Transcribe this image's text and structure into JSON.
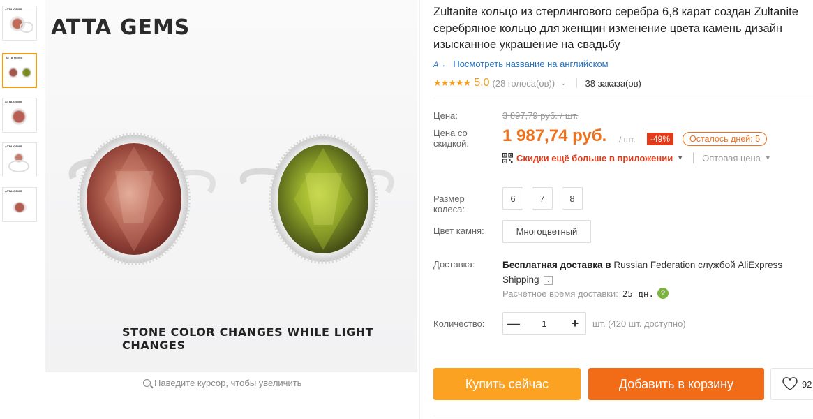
{
  "gallery": {
    "brand_logo": "ATTA GEMS",
    "caption": "STONE COLOR CHANGES WHILE LIGHT CHANGES",
    "zoom_hint": "Наведите курсор, чтобы увеличить",
    "thumbnails": [
      {
        "label": "ATTA GEMS",
        "active": false
      },
      {
        "label": "ATTA GEMS",
        "active": true
      },
      {
        "label": "ATTA GEMS",
        "active": false
      },
      {
        "label": "ATTA GEMS",
        "active": false
      },
      {
        "label": "ATTA GEMS",
        "active": false
      }
    ]
  },
  "product": {
    "title_lines": [
      "Zultanite кольцо из стерлингового серебра 6,8 карат создан Zultanite",
      "серебряное кольцо для женщин изменение цвета камень дизайн",
      "изысканное украшение на свадьбу"
    ],
    "translate_link": "Посмотреть название на английском",
    "translate_icon": "A→",
    "stars": "★★★★★",
    "rating": "5.0",
    "votes": "(28 голоса(ов))",
    "orders": "38 заказа(ов)"
  },
  "pricing": {
    "price_label": "Цена:",
    "old_price": "3 897,79 руб. / шт.",
    "discount_label_1": "Цена со",
    "discount_label_2": "скидкой:",
    "new_price": "1 987,74 руб.",
    "per_unit": "/ шт.",
    "discount_badge": "-49%",
    "days_left": "Осталось дней: 5",
    "app_discount": "Скидки ещё больше в приложении",
    "wholesale": "Оптовая цена"
  },
  "options": {
    "size_label_1": "Размер",
    "size_label_2": "колеса:",
    "sizes": [
      "6",
      "7",
      "8"
    ],
    "color_label": "Цвет камня:",
    "color_value": "Многоцветный"
  },
  "shipping": {
    "label": "Доставка:",
    "free_text": "Бесплатная доставка в",
    "destination": "Russian Federation службой AliExpress",
    "service": "Shipping",
    "eta_label": "Расчётное время доставки:",
    "eta_value": "25 дн."
  },
  "quantity": {
    "label": "Количество:",
    "minus": "—",
    "value": "1",
    "plus": "+",
    "available": "шт. (420 шт. доступно)"
  },
  "actions": {
    "buy_now": "Купить сейчас",
    "add_to_cart": "Добавить в корзину",
    "wishlist_count": "92"
  },
  "colors": {
    "accent_orange": "#f0711c",
    "buy_now_bg": "#fca223",
    "add_cart_bg": "#f26c18",
    "discount_red": "#e03b1b",
    "link_blue": "#2272c3",
    "star_gold": "#f29c1f"
  }
}
